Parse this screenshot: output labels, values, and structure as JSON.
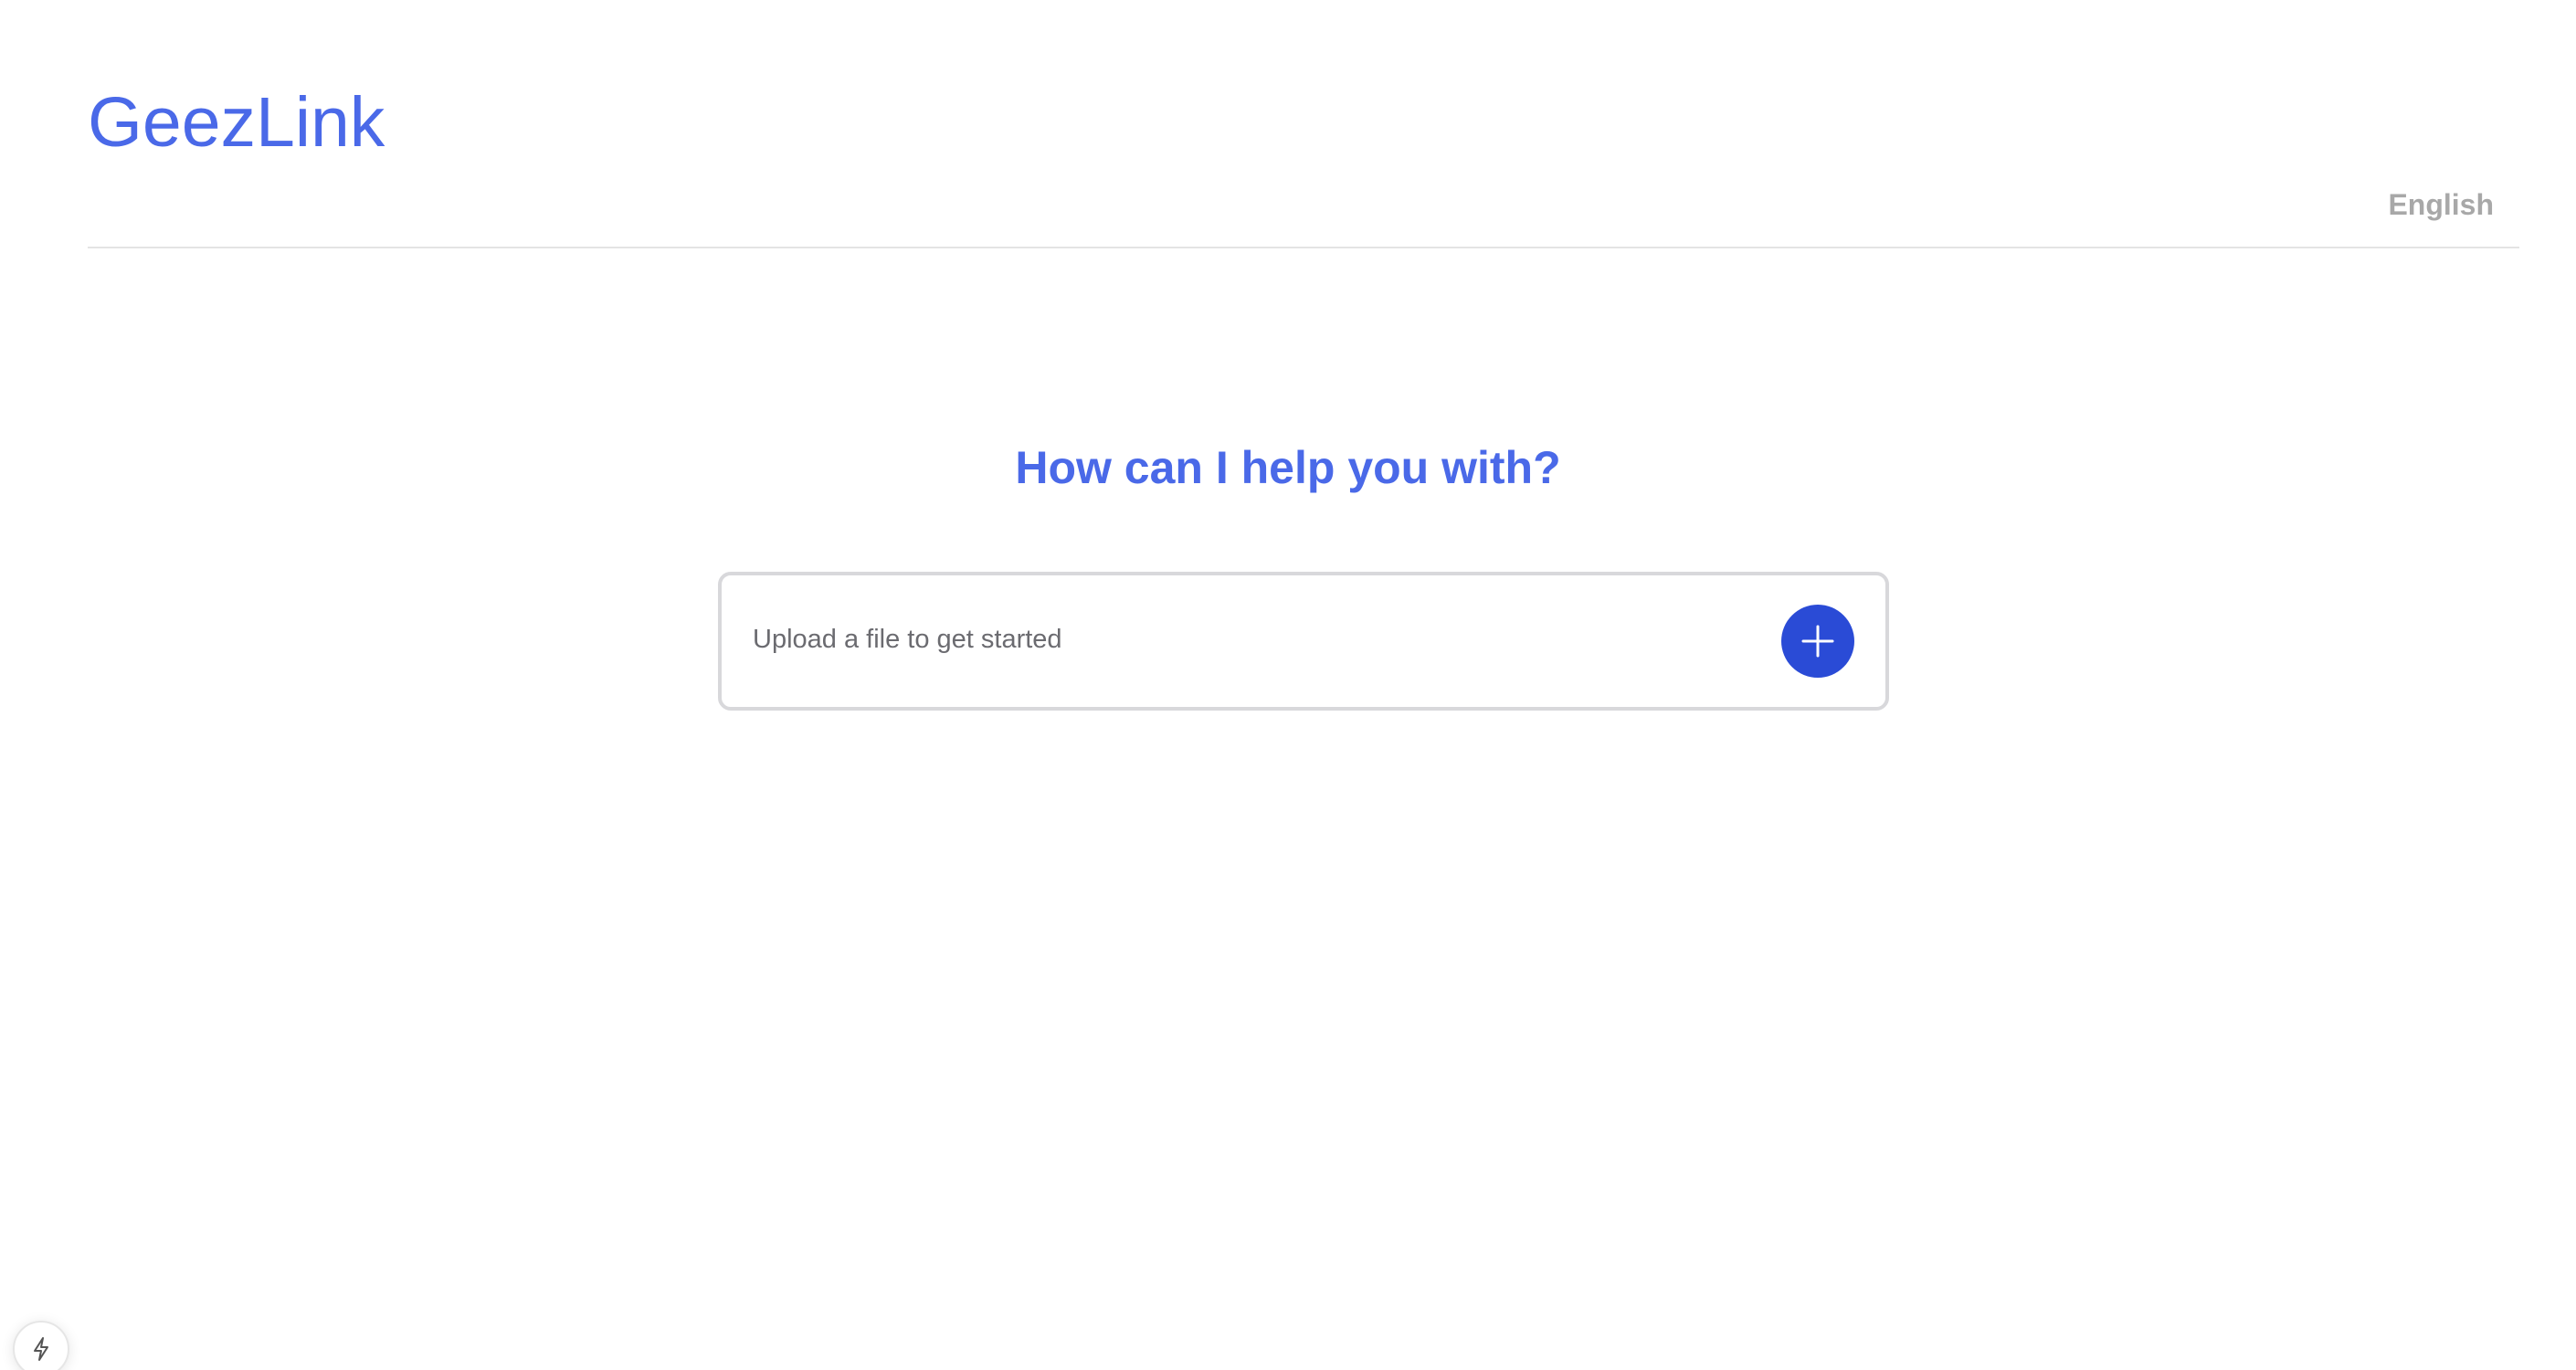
{
  "header": {
    "brand": "GeezLink",
    "language": "English"
  },
  "main": {
    "heading": "How can I help you with?",
    "upload": {
      "placeholder": "Upload a file to get started",
      "add_icon": "plus-icon"
    }
  },
  "corner": {
    "icon": "lightning-icon"
  },
  "colors": {
    "brand": "#4a69e8",
    "button": "#2a4bd6",
    "muted_text": "#a8a8a8",
    "border": "#d8d8db"
  }
}
